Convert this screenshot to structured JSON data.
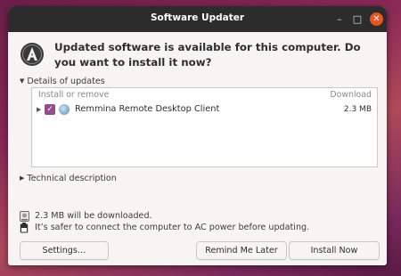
{
  "window": {
    "title": "Software Updater",
    "controls": {
      "minimize": "–",
      "maximize": "□",
      "close": "✕"
    }
  },
  "heading": "Updated software is available for this computer. Do you want to install it now?",
  "details": {
    "expander_label": "Details of updates",
    "col_install": "Install or remove",
    "col_download": "Download",
    "packages": [
      {
        "name": "Remmina Remote Desktop Client",
        "size": "2.3 MB",
        "checked": true
      }
    ]
  },
  "technical": {
    "expander_label": "Technical description"
  },
  "info": {
    "download": "2.3 MB will be downloaded.",
    "power": "It’s safer to connect the computer to AC power before updating."
  },
  "buttons": {
    "settings": "Settings…",
    "remind": "Remind Me Later",
    "install": "Install Now"
  },
  "colors": {
    "titlebar": "#2c2c2c",
    "close_button": "#e95420",
    "checkbox": "#924d8b",
    "window_bg": "#f6f5f4"
  },
  "icons": [
    "software-updater-icon",
    "disk-icon",
    "battery-icon",
    "remmina-icon"
  ]
}
